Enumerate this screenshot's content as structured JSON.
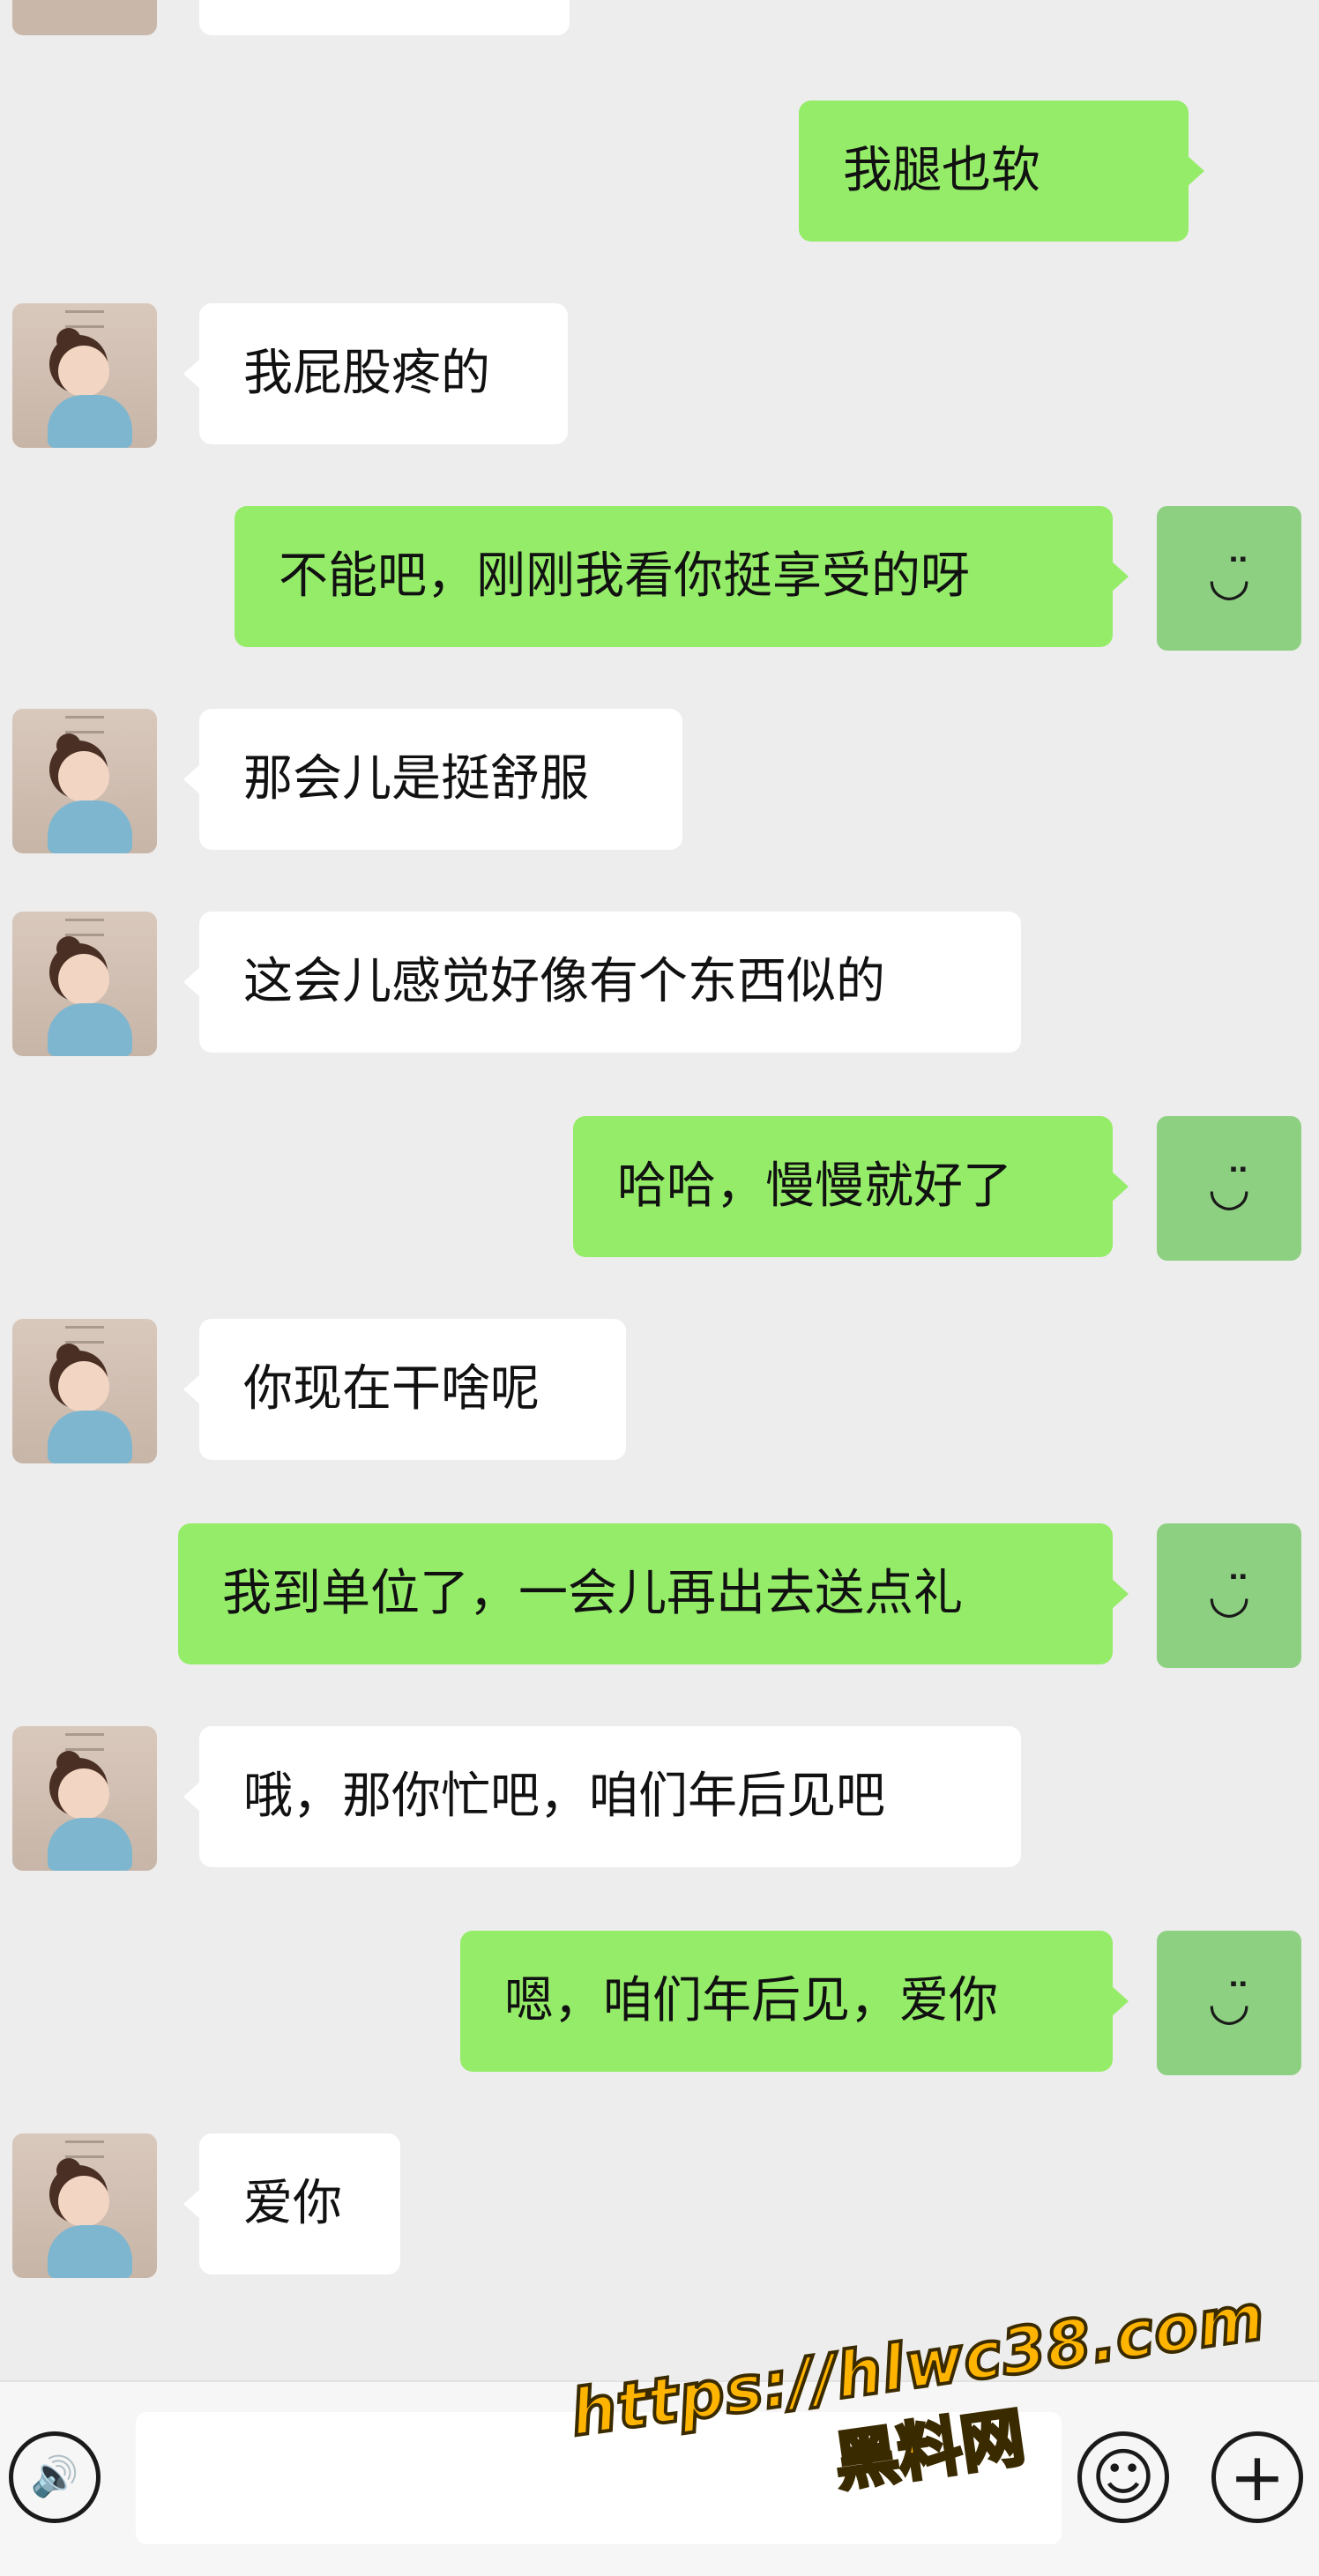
{
  "messages": [
    {
      "side": "out",
      "text": "我腿也软"
    },
    {
      "side": "in",
      "text": "我屁股疼的"
    },
    {
      "side": "out",
      "text": "不能吧，刚刚我看你挺享受的呀"
    },
    {
      "side": "in",
      "text": "那会儿是挺舒服"
    },
    {
      "side": "in",
      "text": "这会儿感觉好像有个东西似的"
    },
    {
      "side": "out",
      "text": "哈哈，慢慢就好了"
    },
    {
      "side": "in",
      "text": "你现在干啥呢"
    },
    {
      "side": "out",
      "text": "我到单位了，一会儿再出去送点礼"
    },
    {
      "side": "in",
      "text": "哦，那你忙吧，咱们年后见吧"
    },
    {
      "side": "out",
      "text": "嗯，咱们年后见，爱你"
    },
    {
      "side": "in",
      "text": "爱你"
    }
  ],
  "me_avatar_glyph": "◡̈",
  "input_bar": {
    "voice_glyph": "🔊",
    "emoji_glyph": "☺",
    "plus_glyph": "+"
  },
  "watermark": {
    "url": "https://hlwc38.com",
    "name": "黑料网"
  },
  "colors": {
    "background": "#ededed",
    "incoming_bubble": "#ffffff",
    "outgoing_bubble": "#95ec69",
    "watermark": "#ffb400"
  }
}
